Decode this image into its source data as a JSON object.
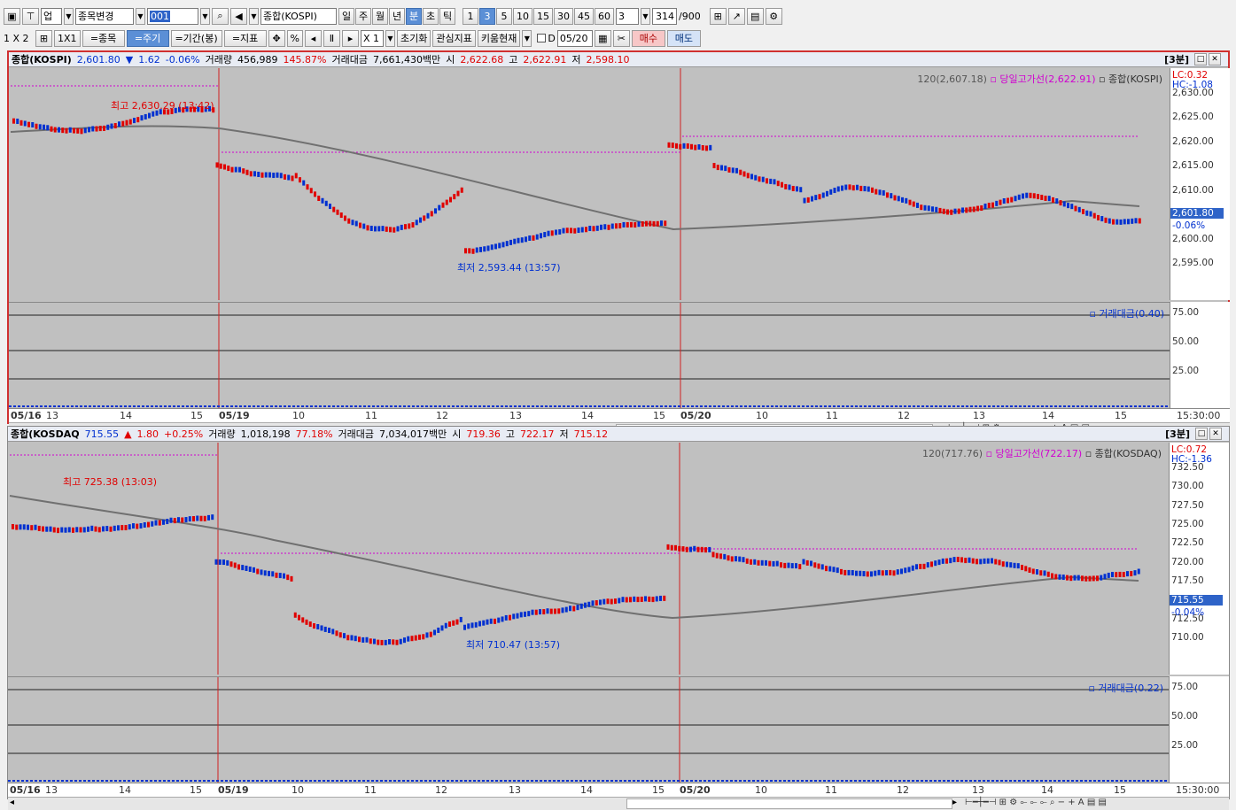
{
  "toolbar1": {
    "market_dd": "업",
    "code_change": "종목변경",
    "code": "001",
    "name": "종합(KOSPI)",
    "periods": [
      "일",
      "주",
      "월",
      "년",
      "분",
      "초",
      "틱"
    ],
    "minutes": [
      "1",
      "3",
      "5",
      "10",
      "15",
      "30",
      "45",
      "60"
    ],
    "interval_value": "3",
    "count": "314",
    "count_max": "/900"
  },
  "toolbar2": {
    "layout": "1 X 2",
    "one_by_one": "1X1",
    "item_btn": "=종목",
    "cycle_btn": "=주기",
    "range_btn": "=기간(봉)",
    "indicator_btn": "=지표",
    "percent": "%",
    "mult": "X 1",
    "reset": "초기화",
    "interest": "관심지표",
    "kiwoom": "키움현재",
    "date_prefix": "D",
    "date": "05/20",
    "buy": "매수",
    "sell": "매도"
  },
  "panels": [
    {
      "id": "kospi",
      "header": {
        "name": "종합(KOSPI)",
        "price": "2,601.80",
        "dir": "▼",
        "change": "1.62",
        "rate": "-0.06%",
        "vol_label": "거래량",
        "volume": "456,989",
        "vol_ratio": "145.87%",
        "amt_label": "거래대금",
        "amount": "7,661,430백만",
        "open_label": "시",
        "open": "2,622.68",
        "high_label": "고",
        "high": "2,622.91",
        "low_label": "저",
        "low": "2,598.10",
        "interval": "[3분]"
      },
      "legend": {
        "ma": "120(2,607.18)",
        "high_line": "당일고가선(2,622.91)",
        "series": "종합(KOSPI)"
      },
      "lc": "LC:0.32",
      "hc": "HC:-1.08",
      "price_label": "2,601.80",
      "rate_label": "-0.06%",
      "y_ticks": [
        "2,630.00",
        "2,625.00",
        "2,620.00",
        "2,615.00",
        "2,610.00",
        "2,605.00",
        "2,600.00",
        "2,595.00"
      ],
      "high_note": "최고 2,630.29 (13:42)",
      "low_note": "최저 2,593.44 (13:57)",
      "sub_legend": "거래대금(0.40)",
      "sub_ticks": [
        "75.00",
        "50.00",
        "25.00"
      ],
      "x_labels": [
        "05/16",
        "13",
        "14",
        "15",
        "05/19",
        "10",
        "11",
        "12",
        "13",
        "14",
        "15",
        "05/20",
        "10",
        "11",
        "12",
        "13",
        "14",
        "15"
      ],
      "time": "15:30:00"
    },
    {
      "id": "kosdaq",
      "header": {
        "name": "종합(KOSDAQ",
        "price": "715.55",
        "dir": "▲",
        "change": "1.80",
        "rate": "+0.25%",
        "vol_label": "거래량",
        "volume": "1,018,198",
        "vol_ratio": "77.18%",
        "amt_label": "거래대금",
        "amount": "7,034,017백만",
        "open_label": "시",
        "open": "719.36",
        "high_label": "고",
        "high": "722.17",
        "low_label": "저",
        "low": "715.12",
        "interval": "[3분]"
      },
      "legend": {
        "ma": "120(717.76)",
        "high_line": "당일고가선(722.17)",
        "series": "종합(KOSDAQ)"
      },
      "lc": "LC:0.72",
      "hc": "HC:-1.36",
      "price_label": "715.55",
      "rate_label": "-0.04%",
      "y_ticks": [
        "732.50",
        "730.00",
        "727.50",
        "725.00",
        "722.50",
        "720.00",
        "717.50",
        "715.00",
        "712.50",
        "710.00"
      ],
      "high_note": "최고 725.38 (13:03)",
      "low_note": "최저 710.47 (13:57)",
      "sub_legend": "거래대금(0.22)",
      "sub_ticks": [
        "75.00",
        "50.00",
        "25.00"
      ],
      "x_labels": [
        "05/16",
        "13",
        "14",
        "15",
        "05/19",
        "10",
        "11",
        "12",
        "13",
        "14",
        "15",
        "05/20",
        "10",
        "11",
        "12",
        "13",
        "14",
        "15"
      ],
      "time": "15:30:00"
    }
  ],
  "colors": {
    "up": "#e00000",
    "down": "#0030d0",
    "ma": "#707070",
    "hiline": "#d000d0"
  }
}
